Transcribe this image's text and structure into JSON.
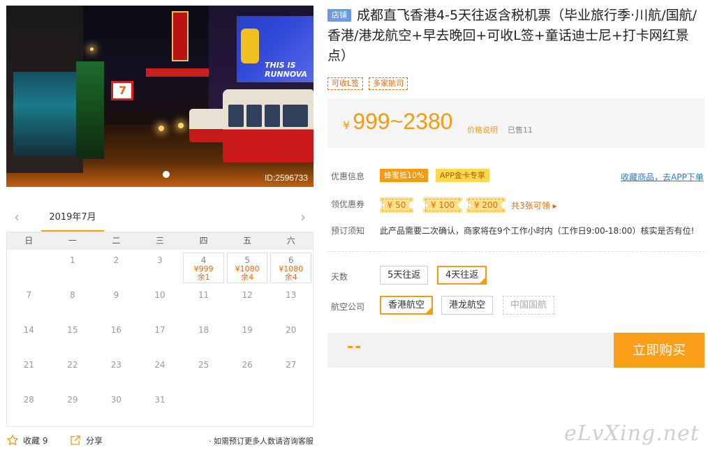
{
  "photo": {
    "image_id": "ID:2596733"
  },
  "calendar": {
    "month": "2019年7月",
    "weekdays": [
      "日",
      "一",
      "二",
      "三",
      "四",
      "五",
      "六"
    ],
    "rows": [
      [
        {
          "d": ""
        },
        {
          "d": "1"
        },
        {
          "d": "2"
        },
        {
          "d": "3"
        },
        {
          "d": "4",
          "p": "¥999",
          "s": "余1"
        },
        {
          "d": "5",
          "p": "¥1080",
          "s": "余4"
        },
        {
          "d": "6",
          "p": "¥1080",
          "s": "余4"
        }
      ],
      [
        {
          "d": "7"
        },
        {
          "d": "8"
        },
        {
          "d": "9"
        },
        {
          "d": "10"
        },
        {
          "d": "11"
        },
        {
          "d": "12"
        },
        {
          "d": "13"
        }
      ],
      [
        {
          "d": "14"
        },
        {
          "d": "15"
        },
        {
          "d": "16"
        },
        {
          "d": "17"
        },
        {
          "d": "18"
        },
        {
          "d": "19"
        },
        {
          "d": "20"
        }
      ],
      [
        {
          "d": "21"
        },
        {
          "d": "22"
        },
        {
          "d": "23"
        },
        {
          "d": "24"
        },
        {
          "d": "25"
        },
        {
          "d": "26"
        },
        {
          "d": "27"
        }
      ],
      [
        {
          "d": "28"
        },
        {
          "d": "29"
        },
        {
          "d": "30"
        },
        {
          "d": "31"
        },
        {
          "d": ""
        },
        {
          "d": ""
        },
        {
          "d": ""
        }
      ]
    ]
  },
  "footer": {
    "favorite_label": "收藏 9",
    "share_label": "分享",
    "note": "· 如需预订更多人数请咨询客服"
  },
  "product": {
    "shop_tag": "店铺",
    "title": "成都直飞香港4-5天往返含税机票（毕业旅行季·川航/国航/香港/港龙航空+早去晚回+可收L签+童话迪士尼+打卡网红景点）",
    "tags": [
      "可收L签",
      "多家航司"
    ]
  },
  "price": {
    "currency": "¥",
    "range": "999~2380",
    "note": "价格说明",
    "sold": "已售11"
  },
  "promo": {
    "label": "优惠信息",
    "badges": [
      "蜂蜜抵10%",
      "APP金卡专享"
    ],
    "fav_link": "收藏商品，去APP下单"
  },
  "coupons": {
    "label": "领优惠券",
    "items": [
      "¥ 50",
      "¥ 100",
      "¥ 200"
    ],
    "get_label": "共3张可领 ▸"
  },
  "booking": {
    "label": "预订须知",
    "text": "此产品需要二次确认，商家将在9个工作小时内（工作日9:00-18:00）核实是否有位!"
  },
  "days": {
    "label": "天数",
    "options": [
      "5天往返",
      "4天往返"
    ],
    "selected": "4天往返"
  },
  "airline": {
    "label": "航空公司",
    "options": [
      "香港航空",
      "港龙航空",
      "中国国航"
    ],
    "selected": "香港航空",
    "disabled": "中国国航"
  },
  "buy": {
    "total": "--",
    "button": "立即购买"
  },
  "watermark": "eLvXing.net",
  "colors": {
    "accent": "#f39c12",
    "buy_button": "#fb9e1a",
    "link": "#2a7ad8",
    "shop_tag": "#6b9ae0"
  }
}
